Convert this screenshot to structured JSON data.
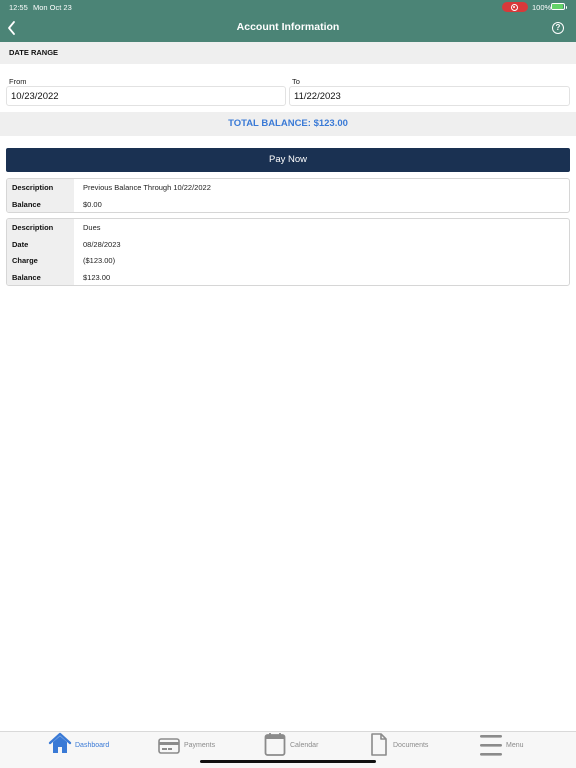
{
  "status_bar": {
    "time": "12:55",
    "date": "Mon Oct 23",
    "battery": "100%"
  },
  "header": {
    "title": "Account Information",
    "back_icon": "chevron-left-icon",
    "help_icon": "question-circle-icon",
    "color": "#4b8476"
  },
  "date_range": {
    "section_label": "DATE RANGE",
    "from_label": "From",
    "from_value": "10/23/2022",
    "to_label": "To",
    "to_value": "11/22/2023"
  },
  "total_balance": "TOTAL BALANCE: $123.00",
  "pay_button": "Pay Now",
  "transactions": [
    {
      "rows": [
        {
          "key": "Description",
          "value": "Previous Balance Through 10/22/2022"
        },
        {
          "key": "Balance",
          "value": "$0.00"
        }
      ]
    },
    {
      "rows": [
        {
          "key": "Description",
          "value": "Dues"
        },
        {
          "key": "Date",
          "value": "08/28/2023"
        },
        {
          "key": "Charge",
          "value": "($123.00)"
        },
        {
          "key": "Balance",
          "value": "$123.00"
        }
      ]
    }
  ],
  "tab_bar": [
    {
      "label": "Dashboard",
      "icon": "home-icon",
      "active": true
    },
    {
      "label": "Payments",
      "icon": "credit-card-icon",
      "active": false
    },
    {
      "label": "Calendar",
      "icon": "calendar-icon",
      "active": false
    },
    {
      "label": "Documents",
      "icon": "document-icon",
      "active": false
    },
    {
      "label": "Menu",
      "icon": "hamburger-menu-icon",
      "active": false
    }
  ],
  "colors": {
    "accent": "#3a7ad6",
    "pay_button": "#1a3152",
    "record_indicator": "#d8393a"
  }
}
